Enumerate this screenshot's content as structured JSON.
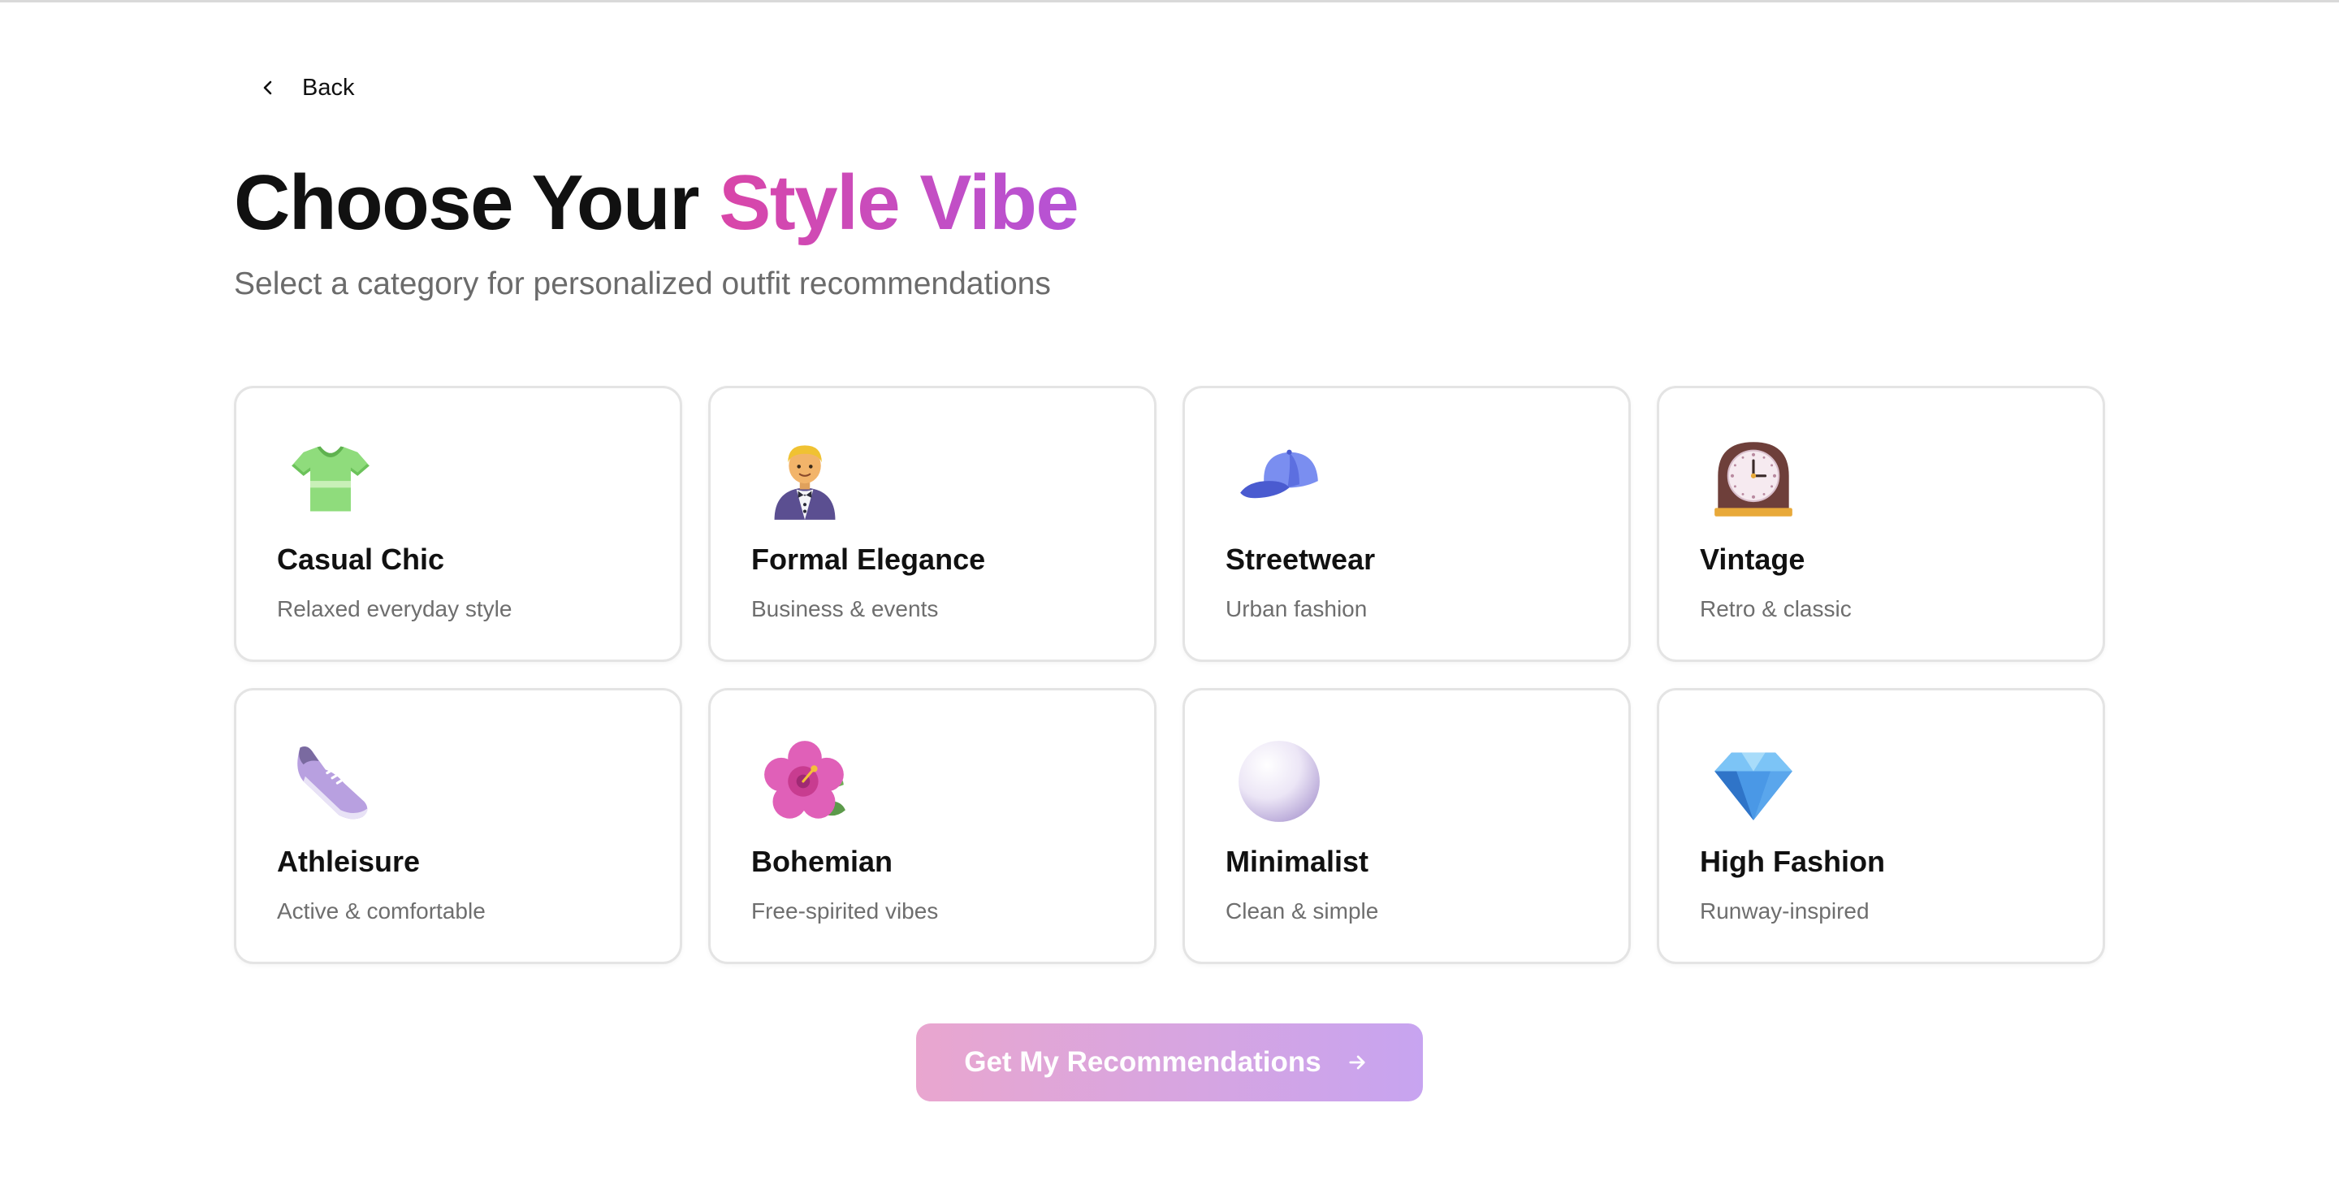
{
  "nav": {
    "back_label": "Back"
  },
  "header": {
    "title_plain": "Choose Your ",
    "title_highlight": "Style Vibe",
    "subtitle": "Select a category for personalized outfit recommendations"
  },
  "categories": [
    {
      "name": "Casual Chic",
      "description": "Relaxed everyday style",
      "icon": "t-shirt-icon"
    },
    {
      "name": "Formal Elegance",
      "description": "Business & events",
      "icon": "person-in-tuxedo-icon"
    },
    {
      "name": "Streetwear",
      "description": "Urban fashion",
      "icon": "billed-cap-icon"
    },
    {
      "name": "Vintage",
      "description": "Retro & classic",
      "icon": "mantelpiece-clock-icon"
    },
    {
      "name": "Athleisure",
      "description": "Active & comfortable",
      "icon": "running-shoe-icon"
    },
    {
      "name": "Bohemian",
      "description": "Free-spirited vibes",
      "icon": "hibiscus-icon"
    },
    {
      "name": "Minimalist",
      "description": "Clean & simple",
      "icon": "white-circle-icon"
    },
    {
      "name": "High Fashion",
      "description": "Runway-inspired",
      "icon": "gem-stone-icon"
    }
  ],
  "cta": {
    "label": "Get My Recommendations"
  },
  "colors": {
    "title_gradient_start": "#d946a8",
    "title_gradient_end": "#b553d6",
    "button_gradient_start": "#e9a6cf",
    "button_gradient_end": "#c7a4f0"
  }
}
